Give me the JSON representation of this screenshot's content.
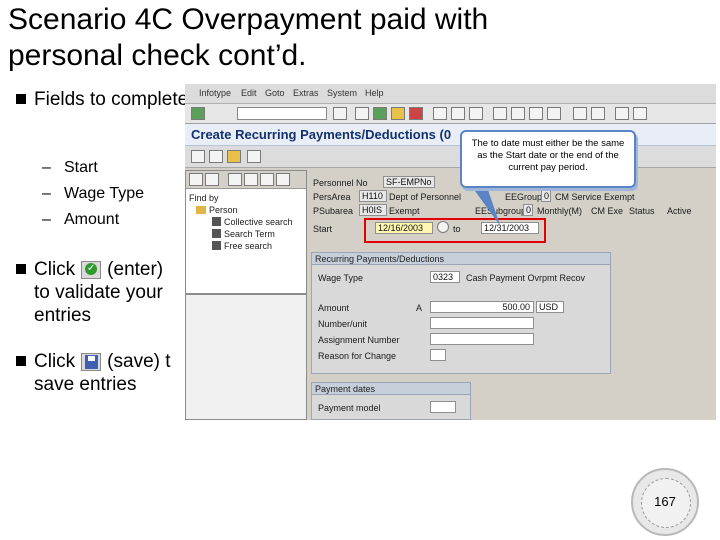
{
  "slide": {
    "title_line1": "Scenario 4C Overpayment paid with",
    "title_line2": "personal check cont’d.",
    "bullet1": "Fields to complete:",
    "sub1": "Start",
    "sub2": "Wage Type",
    "sub3": "Amount",
    "bullet2_a": "Click",
    "bullet2_b": "(enter)",
    "bullet2_c": "to validate your entries",
    "bullet3_a": "Click",
    "bullet3_b": "(save) t",
    "bullet3_c": "save entries",
    "page_number": "167"
  },
  "sap": {
    "menu": [
      "Infotype",
      "Edit",
      "Goto",
      "Extras",
      "System",
      "Help"
    ],
    "screen_title": "Create Recurring Payments/Deductions (0",
    "tree": {
      "find_by": "Find by",
      "person": "Person",
      "collective_search": "Collective search",
      "search_term": "Search Term",
      "free_search": "Free search"
    },
    "header": {
      "personnel_no_label": "Personnel No",
      "personnel_no_value": "SF-EMPNo",
      "pers_area_label": "PersArea",
      "pers_area_value": "H110",
      "pers_area_text": "Dept of Personnel",
      "ee_group_label": "EEGroup",
      "ee_group_value": "0",
      "ee_group_text": "CM Service Exempt",
      "ps_subarea_label": "PSubarea",
      "ps_subarea_value": "H0IS",
      "ps_subarea_text": "Exempt",
      "ee_subgroup_label": "EESubgroup",
      "ee_subgroup_value": "0",
      "ee_subgroup_text": "Monthly(M)",
      "ee_subgroup_text2": "CM Exe",
      "status_label": "Status",
      "status_value": "Active",
      "start_label": "Start",
      "start_value": "12/16/2003",
      "to_label": "to",
      "to_value": "12/31/2003"
    },
    "recurring_box": {
      "title": "Recurring Payments/Deductions",
      "wage_type_label": "Wage Type",
      "wage_type_value": "0323",
      "wage_type_text": "Cash Payment Ovrpmt Recov",
      "amount_label": "Amount",
      "amount_sign": "A",
      "amount_value": "500.00",
      "currency": "USD",
      "number_unit_label": "Number/unit",
      "assignment_label": "Assignment Number",
      "reason_label": "Reason for Change"
    },
    "payment_box": {
      "title": "Payment dates",
      "payment_model_label": "Payment model"
    },
    "callout": "The to date must either be the same as the Start date or the end of the current pay period."
  },
  "colors": {
    "title_blue": "#12316e",
    "highlight_red": "#e00000",
    "callout_border": "#5b84c4"
  }
}
